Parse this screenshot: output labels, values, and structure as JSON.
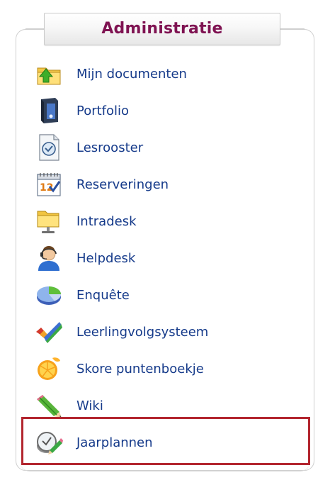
{
  "panel": {
    "title": "Administratie",
    "title_color": "#7f1352",
    "link_color": "#153a8a",
    "highlight_color": "#b3262f"
  },
  "menu": {
    "items": [
      {
        "label": "Mijn documenten",
        "icon": "folder-upload-icon"
      },
      {
        "label": "Portfolio",
        "icon": "binder-icon"
      },
      {
        "label": "Lesrooster",
        "icon": "clock-document-icon"
      },
      {
        "label": "Reserveringen",
        "icon": "calendar-check-icon"
      },
      {
        "label": "Intradesk",
        "icon": "folder-monitor-icon"
      },
      {
        "label": "Helpdesk",
        "icon": "support-agent-icon"
      },
      {
        "label": "Enquête",
        "icon": "pie-chart-icon"
      },
      {
        "label": "Leerlingvolgsysteem",
        "icon": "checkmark-icon"
      },
      {
        "label": "Skore puntenboekje",
        "icon": "orange-slice-icon"
      },
      {
        "label": "Wiki",
        "icon": "pencil-icon"
      },
      {
        "label": "Jaarplannen",
        "icon": "clock-pencil-icon",
        "highlighted": true
      }
    ]
  }
}
